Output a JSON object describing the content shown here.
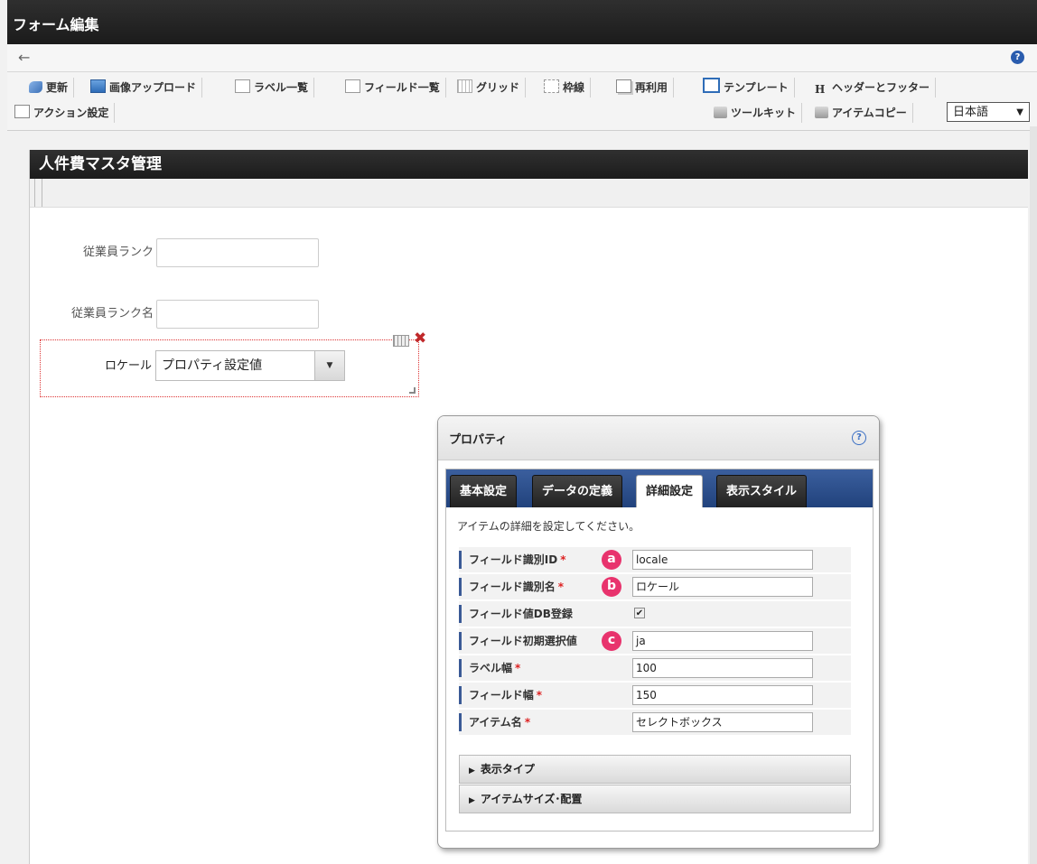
{
  "window": {
    "title": "フォーム編集"
  },
  "nav": {
    "back_icon": "arrow-left-icon",
    "help_label": "?"
  },
  "toolbar": {
    "items": [
      "更新",
      "画像アップロード",
      "ラベル一覧",
      "フィールド一覧",
      "グリッド",
      "枠線",
      "再利用",
      "テンプレート",
      "ヘッダーとフッター"
    ],
    "header_footer_glyph": "H",
    "action_label": "アクション設定",
    "toolkit_label": "ツールキット",
    "item_copy_label": "アイテムコピー",
    "language": "日本語",
    "language_caret": "▼"
  },
  "form": {
    "title": "人件費マスタ管理",
    "fields": [
      {
        "label": "従業員ランク",
        "value": ""
      },
      {
        "label": "従業員ランク名",
        "value": ""
      }
    ],
    "select_item": {
      "label": "ロケール",
      "value": "プロパティ設定値",
      "caret": "▼",
      "delete_glyph": "✖"
    }
  },
  "properties": {
    "title": "プロパティ",
    "help": "?",
    "tabs": [
      "基本設定",
      "データの定義",
      "詳細設定",
      "表示スタイル"
    ],
    "active_tab": "詳細設定",
    "description": "アイテムの詳細を設定してください。",
    "rows": [
      {
        "label": "フィールド識別ID",
        "required": "*",
        "badge": "a",
        "value": "locale"
      },
      {
        "label": "フィールド識別名",
        "required": "*",
        "badge": "b",
        "value": "ロケール"
      },
      {
        "label": "フィールド値DB登録",
        "required": "",
        "badge": "",
        "checked": "✔"
      },
      {
        "label": "フィールド初期選択値",
        "required": "",
        "badge": "c",
        "value": "ja"
      },
      {
        "label": "ラベル幅",
        "required": "*",
        "badge": "",
        "value": "100"
      },
      {
        "label": "フィールド幅",
        "required": "*",
        "badge": "",
        "value": "150"
      },
      {
        "label": "アイテム名",
        "required": "*",
        "badge": "",
        "value": "セレクトボックス"
      }
    ],
    "accordions": [
      {
        "label": "表示タイプ",
        "tri": "▶"
      },
      {
        "label": "アイテムサイズ･配置",
        "tri": "▶"
      }
    ]
  },
  "colors": {
    "badge": "#e8336d",
    "tab_bar": "#2c4e8a",
    "title_bar": "#222222"
  }
}
